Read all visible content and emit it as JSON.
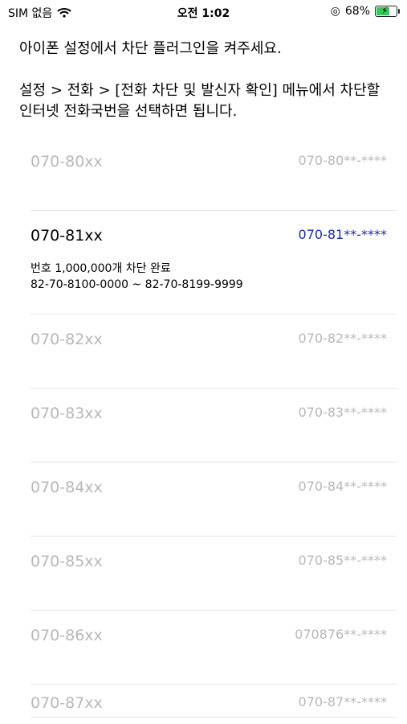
{
  "status_bar": {
    "carrier": "SIM 없음",
    "time": "오전 1:02",
    "battery": "68%"
  },
  "instructions": {
    "line1": "아이폰 설정에서 차단 플러그인을 켜주세요.",
    "line2": "설정 > 전화 > [전화 차단 및 발신자 확인] 메뉴에서 차단할 인터넷 전화국번을 선택하면 됩니다."
  },
  "rows": [
    {
      "prefix": "070-80xx",
      "pattern": "070-80**-****"
    },
    {
      "prefix": "070-81xx",
      "pattern": "070-81**-****",
      "detail1": "번호 1,000,000개 차단 완료",
      "detail2": "82-70-8100-0000 ~ 82-70-8199-9999"
    },
    {
      "prefix": "070-82xx",
      "pattern": "070-82**-****"
    },
    {
      "prefix": "070-83xx",
      "pattern": "070-83**-****"
    },
    {
      "prefix": "070-84xx",
      "pattern": "070-84**-****"
    },
    {
      "prefix": "070-85xx",
      "pattern": "070-85**-****"
    },
    {
      "prefix": "070-86xx",
      "pattern": "070876**-****"
    },
    {
      "prefix": "070-87xx",
      "pattern": "070-87**-****"
    }
  ]
}
